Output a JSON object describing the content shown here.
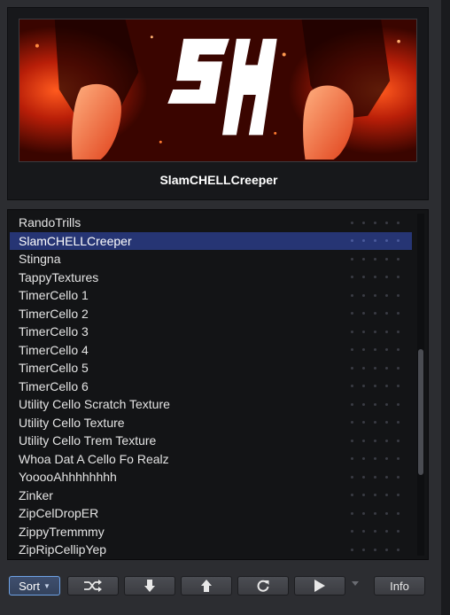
{
  "preview": {
    "logo_text": "SH",
    "title": "SlamCHELLCreeper"
  },
  "list": {
    "selected_index": 1,
    "items": [
      {
        "label": "RandoTrills"
      },
      {
        "label": "SlamCHELLCreeper"
      },
      {
        "label": "Stingna"
      },
      {
        "label": "TappyTextures"
      },
      {
        "label": "TimerCello 1"
      },
      {
        "label": "TimerCello 2"
      },
      {
        "label": "TimerCello 3"
      },
      {
        "label": "TimerCello 4"
      },
      {
        "label": "TimerCello 5"
      },
      {
        "label": "TimerCello 6"
      },
      {
        "label": "Utility Cello Scratch Texture"
      },
      {
        "label": "Utility Cello Texture"
      },
      {
        "label": "Utility Cello Trem Texture"
      },
      {
        "label": "Whoa Dat A Cello Fo Realz"
      },
      {
        "label": "YooooAhhhhhhhh"
      },
      {
        "label": "Zinker"
      },
      {
        "label": "ZipCelDropER"
      },
      {
        "label": "ZippyTremmmy"
      },
      {
        "label": "ZipRipCellipYep"
      }
    ],
    "scroll_position": 0.62
  },
  "toolbar": {
    "sort_label": "Sort",
    "info_label": "Info",
    "icons": [
      "shuffle-icon",
      "arrow-down-icon",
      "arrow-up-icon",
      "refresh-icon",
      "play-icon",
      "chevron-down-icon"
    ]
  },
  "colors": {
    "selection": "#263574",
    "sort_border": "#6ea2e6",
    "background": "#2c2d31"
  }
}
